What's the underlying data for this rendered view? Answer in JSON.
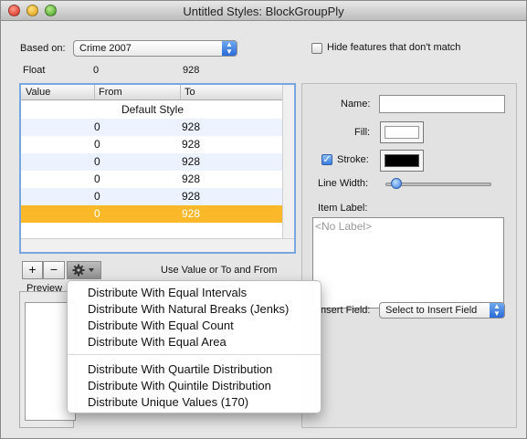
{
  "window": {
    "title": "Untitled Styles: BlockGroupPly"
  },
  "based_on": {
    "label": "Based on:",
    "value": "Crime 2007"
  },
  "hide_features": {
    "label": "Hide features that don't match",
    "checked": false
  },
  "summary": {
    "type": "Float",
    "from": "0",
    "to": "928"
  },
  "table": {
    "headers": [
      "Value",
      "From",
      "To"
    ],
    "default_row": "Default Style",
    "rows": [
      {
        "from": "0",
        "to": "928"
      },
      {
        "from": "0",
        "to": "928"
      },
      {
        "from": "0",
        "to": "928"
      },
      {
        "from": "0",
        "to": "928"
      },
      {
        "from": "0",
        "to": "928"
      },
      {
        "from": "0",
        "to": "928"
      }
    ],
    "selected_index": 5,
    "selected_color": "#fbb829"
  },
  "toolbar": {
    "add": "+",
    "remove": "−",
    "gear": "gear-icon",
    "use_value_text": "Use Value or To and From"
  },
  "preview": {
    "label": "Preview"
  },
  "panel": {
    "name_label": "Name:",
    "name_value": "",
    "fill_label": "Fill:",
    "fill_color": "#ffffff",
    "stroke_label": "Stroke:",
    "stroke_checked": true,
    "stroke_color": "#000000",
    "line_width_label": "Line Width:",
    "item_label_label": "Item Label:",
    "item_label_placeholder": "<No Label>",
    "insert_field_label": "Insert Field:",
    "insert_field_value": "Select to Insert Field"
  },
  "menu": {
    "group1": [
      "Distribute With Equal Intervals",
      "Distribute With Natural Breaks (Jenks)",
      "Distribute With Equal Count",
      "Distribute With Equal Area"
    ],
    "group2": [
      "Distribute With Quartile Distribution",
      "Distribute With Quintile Distribution",
      "Distribute Unique Values (170)"
    ]
  },
  "colors": {
    "accent": "#3a7be0",
    "selection": "#fbb829",
    "stripe": "#edf3fe"
  }
}
